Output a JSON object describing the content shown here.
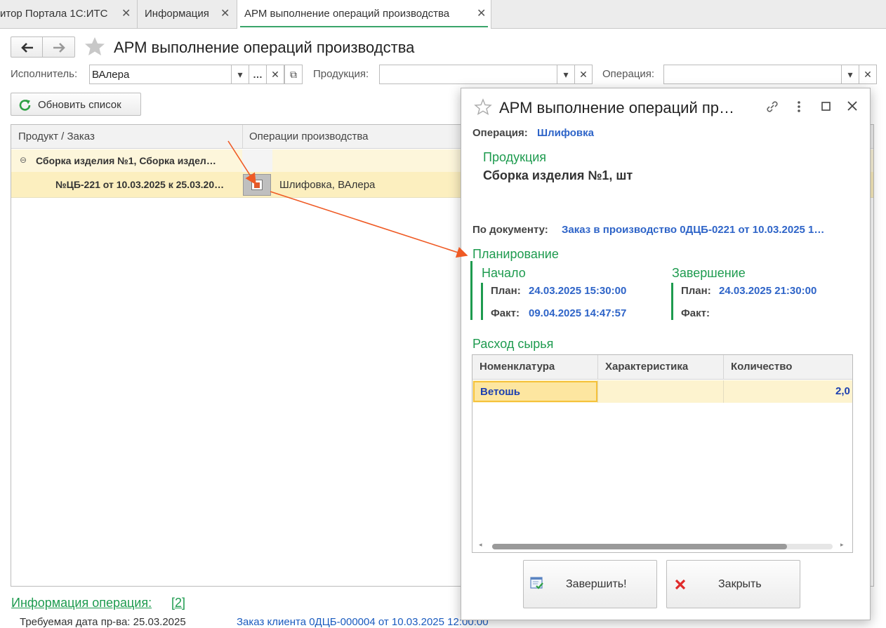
{
  "tabs": [
    {
      "label": "итор Портала 1С:ИТС",
      "active": false
    },
    {
      "label": "Информация",
      "active": false
    },
    {
      "label": "АРМ выполнение операций производства",
      "active": true
    }
  ],
  "page": {
    "title": "АРМ выполнение операций производства"
  },
  "filters": {
    "executor_label": "Исполнитель:",
    "executor_value": "ВАлера",
    "product_label": "Продукция:",
    "product_value": "",
    "operation_label": "Операция:",
    "operation_value": ""
  },
  "toolbar": {
    "refresh_label": "Обновить список"
  },
  "grid": {
    "columns": [
      "Продукт / Заказ",
      "Операции производства"
    ],
    "group_row": "Сборка изделия №1, Сборка издел…",
    "order_row": "№ЦБ-221 от 10.03.2025 к 25.03.20…",
    "operation_cell": "Шлифовка, ВАлера"
  },
  "info": {
    "title": "Информация операция:",
    "count": "[2]",
    "required_date": "Требуемая дата пр-ва: 25.03.2025",
    "client_order": "Заказ клиента 0ДЦБ-000004 от 10.03.2025 12:00:00"
  },
  "dialog": {
    "title": "АРМ выполнение операций пр…",
    "operation_label": "Операция:",
    "operation_value": "Шлифовка",
    "product_heading": "Продукция",
    "product_value": "Сборка изделия №1, шт",
    "document_label": "По документу:",
    "document_value": "Заказ в производство 0ДЦБ-0221 от 10.03.2025 1…",
    "planning_heading": "Планирование",
    "start_heading": "Начало",
    "end_heading": "Завершение",
    "plan_label": "План:",
    "fact_label": "Факт:",
    "start_plan": "24.03.2025 15:30:00",
    "start_fact": "09.04.2025 14:47:57",
    "end_plan": "24.03.2025 21:30:00",
    "end_fact": "",
    "raw_heading": "Расход сырья",
    "raw_columns": [
      "Номенклатура",
      "Характеристика",
      "Количество"
    ],
    "raw_rows": [
      {
        "item": "Ветошь",
        "characteristic": "",
        "qty": "2,0"
      }
    ],
    "finish_button": "Завершить!",
    "close_button": "Закрыть"
  },
  "colors": {
    "accent_green": "#1e9b4f",
    "link_blue": "#2e64c8",
    "arrow": "#ef5a24",
    "row_selected": "#fcefbf"
  }
}
